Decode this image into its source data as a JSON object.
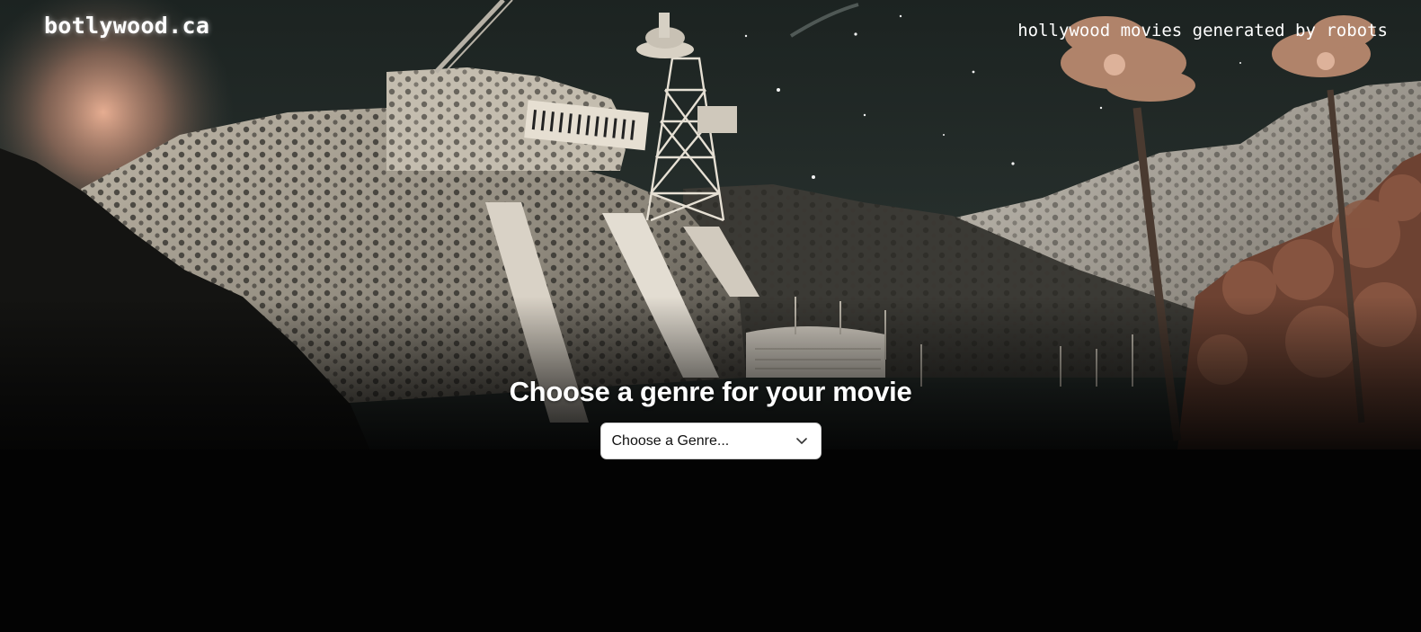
{
  "header": {
    "logo_text": "botlywood.ca",
    "tagline": "hollywood movies generated by robots"
  },
  "main": {
    "heading": "Choose a genre for your movie",
    "genre_select": {
      "selected_value": "Choose a Genre..."
    }
  },
  "icons": {
    "select_chevron": "chevron-down-icon"
  },
  "colors": {
    "background": "#030303",
    "text": "#ffffff",
    "select_bg": "#ffffff",
    "sunset_glow": "#e8a98a"
  }
}
